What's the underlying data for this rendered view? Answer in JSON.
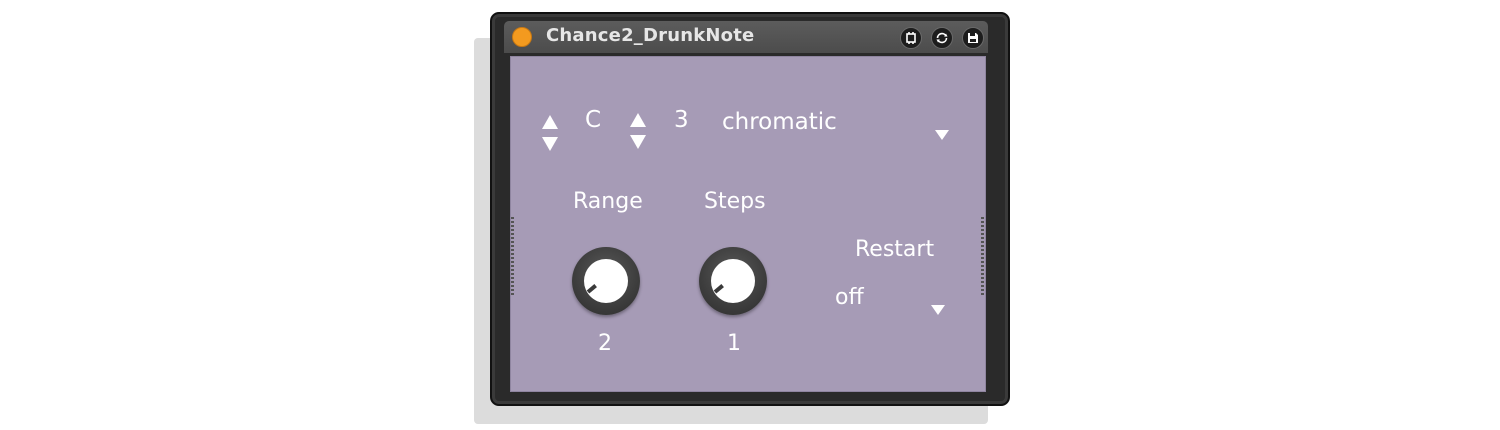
{
  "device": {
    "title": "Chance2_DrunkNote",
    "power_color": "#f39a1f",
    "panel_color": "#a69bb6",
    "header_buttons": [
      {
        "name": "hotswap-icon"
      },
      {
        "name": "refresh-icon"
      },
      {
        "name": "save-icon"
      }
    ]
  },
  "root": {
    "note": "C",
    "octave": "3",
    "scale": "chromatic"
  },
  "knobs": {
    "range": {
      "label": "Range",
      "value": "2"
    },
    "steps": {
      "label": "Steps",
      "value": "1"
    }
  },
  "restart": {
    "label": "Restart",
    "value": "off"
  }
}
